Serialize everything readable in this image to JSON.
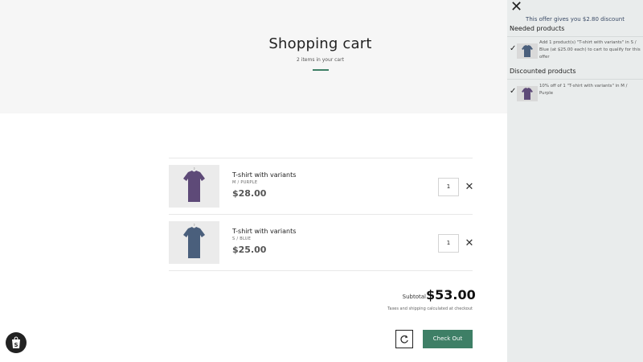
{
  "header": {
    "title": "Shopping cart",
    "subtitle": "2 items in your cart"
  },
  "cart": {
    "items": [
      {
        "name": "T-shirt with variants",
        "variant": "M / PURPLE",
        "price": "$28.00",
        "qty": "1",
        "color": "#5e4a78"
      },
      {
        "name": "T-shirt with variants",
        "variant": "S / BLUE",
        "price": "$25.00",
        "qty": "1",
        "color": "#4a5f7c"
      }
    ],
    "subtotal_label": "Subtotal",
    "subtotal": "$53.00",
    "taxes_note": "Taxes and shipping calculated at checkout",
    "checkout_label": "Check Out"
  },
  "offer_panel": {
    "offer_text": "This offer gives you $2.80 discount",
    "needed_title": "Needed products",
    "needed_desc": "Add 1 product(s) \"T-shirt with variants\" in S / Blue (at $25.00 each) to cart to qualify for this offer",
    "discounted_title": "Discounted products",
    "discounted_desc": "10% off of 1 \"T-shirt with variants\" in M / Purple"
  },
  "icons": {
    "close": "close-icon",
    "remove": "remove-icon",
    "refresh": "refresh-icon",
    "check": "checkmark-icon",
    "shopify": "shopify-bag-icon"
  },
  "colors": {
    "accent": "#3e7f66",
    "panel_bg": "#e9ecec",
    "hero_bg": "#f6f6f6"
  }
}
